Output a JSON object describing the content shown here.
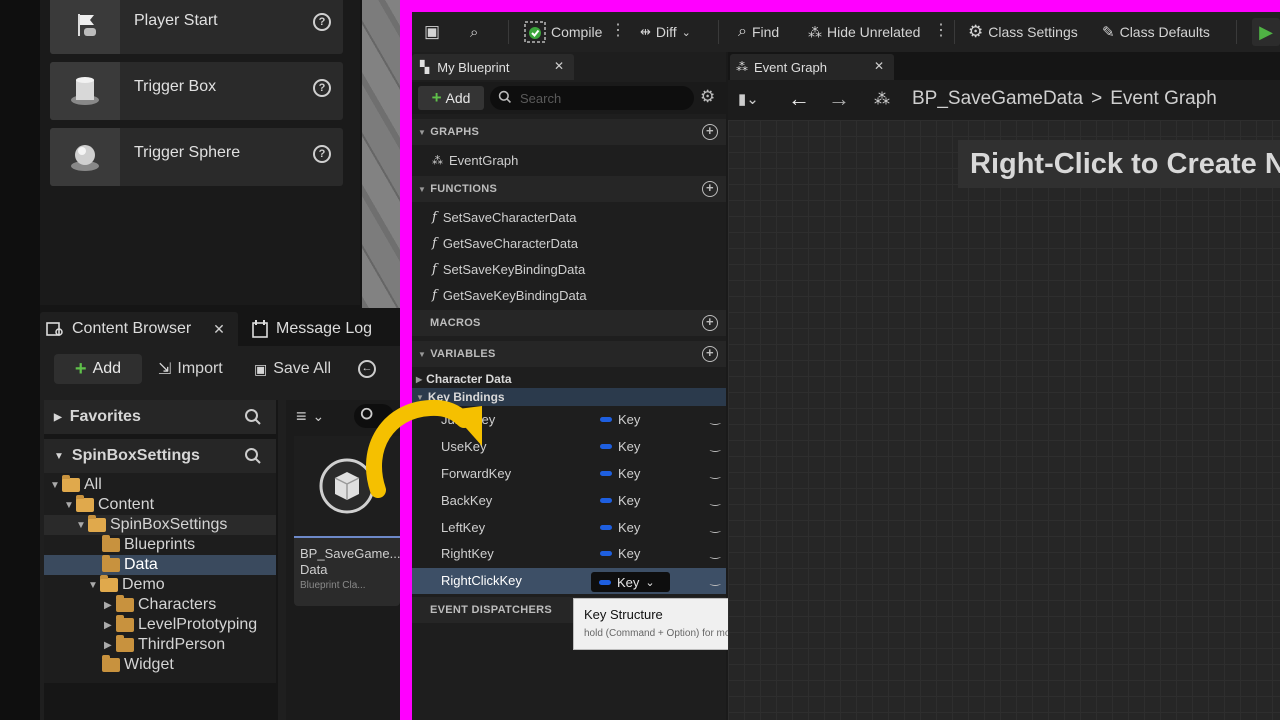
{
  "place_actors": [
    {
      "label": "Player Start",
      "icon": "flag-icon"
    },
    {
      "label": "Trigger Box",
      "icon": "cylinder-icon"
    },
    {
      "label": "Trigger Sphere",
      "icon": "sphere-icon"
    }
  ],
  "content_browser": {
    "tab_label": "Content Browser",
    "message_log_label": "Message Log",
    "add_label": "Add",
    "import_label": "Import",
    "save_all_label": "Save All",
    "favorites_label": "Favorites",
    "collection_label": "SpinBoxSettings",
    "tree": [
      {
        "label": "All",
        "depth": 0,
        "open": true,
        "selected": false
      },
      {
        "label": "Content",
        "depth": 1,
        "open": true,
        "selected": false
      },
      {
        "label": "SpinBoxSettings",
        "depth": 2,
        "open": true,
        "selected": false
      },
      {
        "label": "Blueprints",
        "depth": 3,
        "open": false,
        "selected": false
      },
      {
        "label": "Data",
        "depth": 3,
        "open": false,
        "selected": true
      },
      {
        "label": "Demo",
        "depth": 2,
        "open": true,
        "selected": false
      },
      {
        "label": "Characters",
        "depth": 3,
        "open": false,
        "selected": false
      },
      {
        "label": "LevelPrototyping",
        "depth": 3,
        "open": false,
        "selected": false
      },
      {
        "label": "ThirdPerson",
        "depth": 3,
        "open": false,
        "selected": false
      },
      {
        "label": "Widget",
        "depth": 3,
        "open": false,
        "selected": false
      }
    ],
    "asset": {
      "name_line1": "BP_SaveGame...",
      "name_line2": "Data",
      "type": "Blueprint Cla..."
    }
  },
  "toolbar": {
    "compile": "Compile",
    "diff": "Diff",
    "find": "Find",
    "hide_unrelated": "Hide Unrelated",
    "class_settings": "Class Settings",
    "class_defaults": "Class Defaults"
  },
  "my_blueprint": {
    "tab_label": "My Blueprint",
    "add_label": "Add",
    "search_placeholder": "Search",
    "sections": {
      "graphs": "GRAPHS",
      "functions": "FUNCTIONS",
      "macros": "MACROS",
      "variables": "VARIABLES",
      "event_dispatchers": "EVENT DISPATCHERS"
    },
    "graphs": [
      "EventGraph"
    ],
    "functions": [
      "SetSaveCharacterData",
      "GetSaveCharacterData",
      "SetSaveKeyBindingData",
      "GetSaveKeyBindingData"
    ],
    "categories": {
      "character_data": "Character Data",
      "key_bindings": "Key Bindings"
    },
    "variables": [
      {
        "name": "JumpKey",
        "type": "Key"
      },
      {
        "name": "UseKey",
        "type": "Key"
      },
      {
        "name": "ForwardKey",
        "type": "Key"
      },
      {
        "name": "BackKey",
        "type": "Key"
      },
      {
        "name": "LeftKey",
        "type": "Key"
      },
      {
        "name": "RightKey",
        "type": "Key"
      },
      {
        "name": "RightClickKey",
        "type": "Key"
      }
    ],
    "selected_variable_type": "Key"
  },
  "tooltip": {
    "title": "Key Structure",
    "hint": "hold (Command + Option) for more"
  },
  "graph": {
    "tab_label": "Event Graph",
    "breadcrumb_asset": "BP_SaveGameData",
    "breadcrumb_sep": ">",
    "breadcrumb_graph": "Event Graph",
    "hint": "Right-Click to Create Ne"
  },
  "colors": {
    "highlight_frame": "#ff00ff",
    "annotation_arrow": "#f5c000",
    "variable_pin": "#1e5fe0",
    "folder": "#c8923e"
  }
}
